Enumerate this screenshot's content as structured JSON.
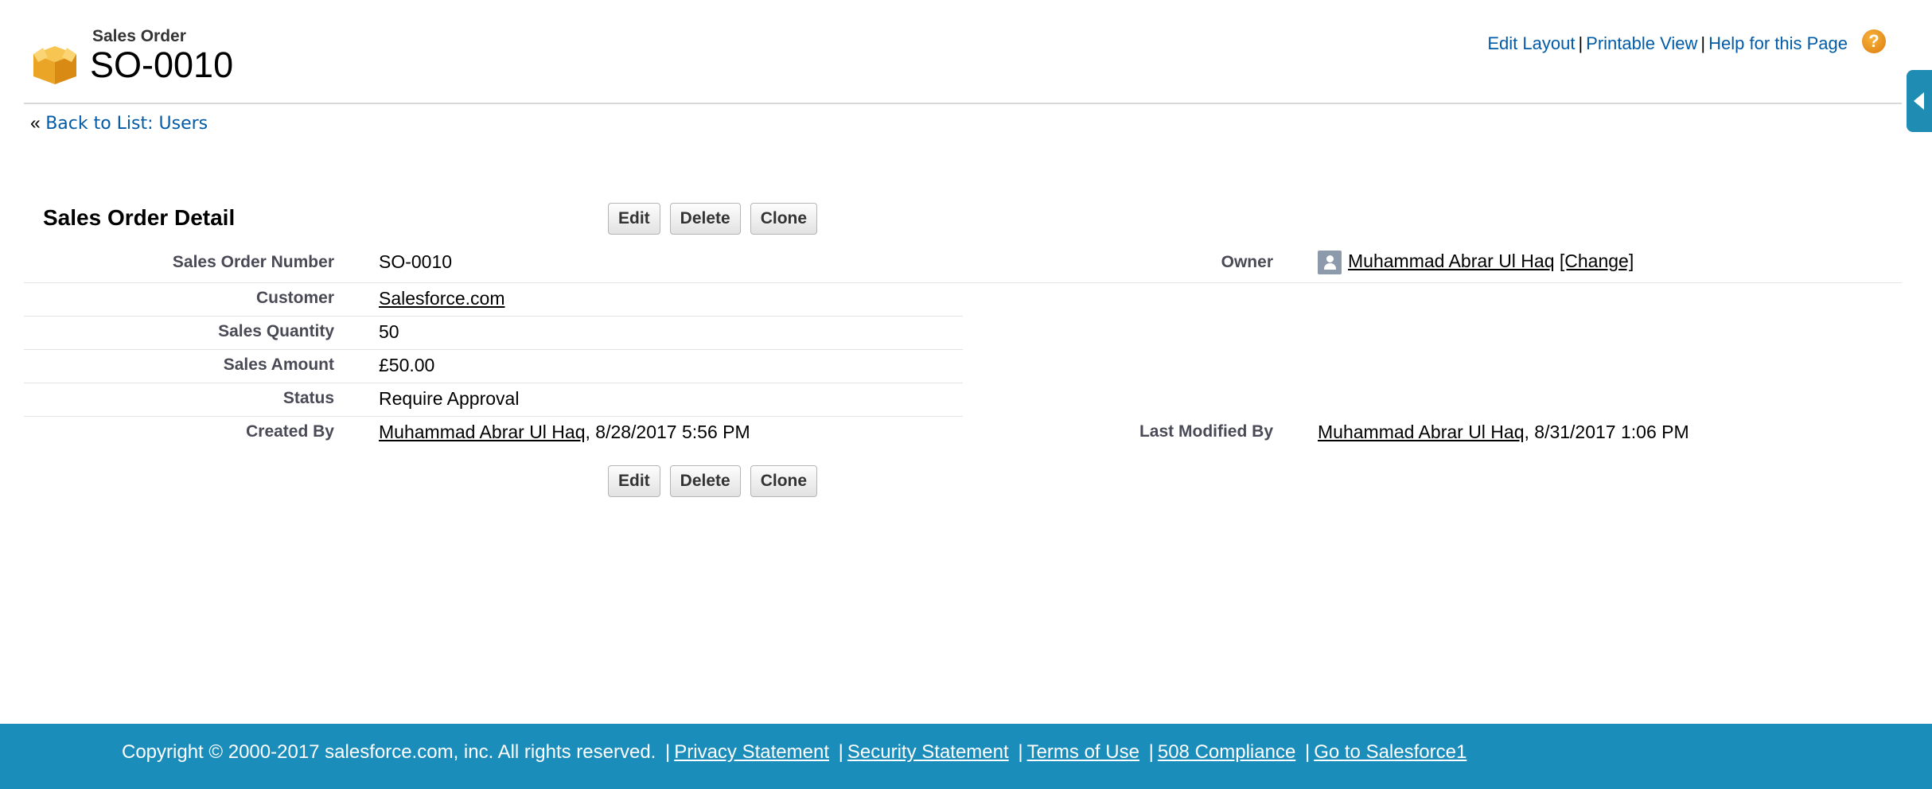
{
  "header": {
    "object_type": "Sales Order",
    "record_name": "SO-0010",
    "links": [
      "Edit Layout",
      "Printable View",
      "Help for this Page"
    ],
    "help_glyph": "?"
  },
  "back_link": {
    "prefix": "«",
    "label": "Back to List: Users"
  },
  "detail": {
    "title": "Sales Order Detail",
    "buttons": [
      "Edit",
      "Delete",
      "Clone"
    ],
    "fields": {
      "sales_order_number": {
        "label": "Sales Order Number",
        "value": "SO-0010"
      },
      "customer": {
        "label": "Customer",
        "value": "Salesforce.com"
      },
      "sales_quantity": {
        "label": "Sales Quantity",
        "value": "50"
      },
      "sales_amount": {
        "label": "Sales Amount",
        "value": "£50.00"
      },
      "status": {
        "label": "Status",
        "value": "Require Approval"
      },
      "created_by": {
        "label": "Created By",
        "user": "Muhammad Abrar Ul Haq",
        "date": ", 8/28/2017 5:56 PM"
      },
      "owner": {
        "label": "Owner",
        "user": "Muhammad Abrar Ul Haq",
        "change": "[Change]"
      },
      "last_modified_by": {
        "label": "Last Modified By",
        "user": "Muhammad Abrar Ul Haq",
        "date": ", 8/31/2017 1:06 PM"
      }
    }
  },
  "footer": {
    "copyright": "Copyright © 2000-2017 salesforce.com, inc. All rights reserved.",
    "links": [
      "Privacy Statement",
      "Security Statement",
      "Terms of Use",
      "508 Compliance",
      "Go to Salesforce1"
    ],
    "separator": "|"
  },
  "colors": {
    "link": "#015ba7",
    "footer_bg": "#1b8dbb",
    "sidebar_tab": "#1f8db3"
  },
  "icons": [
    "box-icon",
    "help-icon",
    "sidebar-collapse-icon",
    "user-icon"
  ]
}
